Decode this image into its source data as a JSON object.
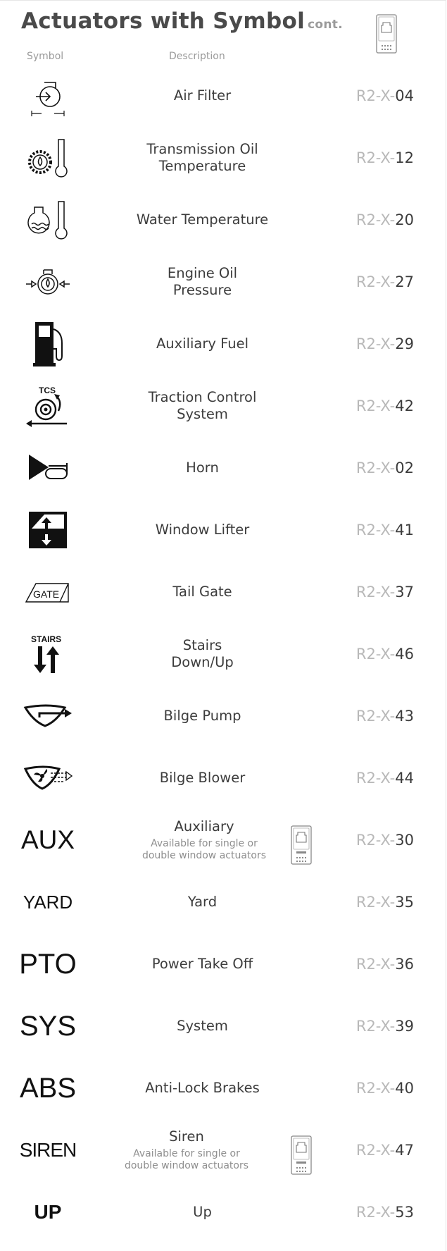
{
  "header": {
    "title": "Actuators with Symbol",
    "cont": "cont.",
    "col_symbol": "Symbol",
    "col_description": "Description"
  },
  "rows": [
    {
      "symbol": "air-filter-icon",
      "desc": "Air Filter",
      "note": "",
      "prefix": "R2-X-",
      "num": "04"
    },
    {
      "symbol": "transmission-oil-temp-icon",
      "desc_lines": [
        "Transmission Oil",
        "Temperature"
      ],
      "prefix": "R2-X-",
      "num": "12"
    },
    {
      "symbol": "water-temp-icon",
      "desc": "Water Temperature",
      "prefix": "R2-X-",
      "num": "20"
    },
    {
      "symbol": "engine-oil-pressure-icon",
      "desc_lines": [
        "Engine Oil",
        "Pressure"
      ],
      "prefix": "R2-X-",
      "num": "27"
    },
    {
      "symbol": "fuel-pump-icon",
      "desc": "Auxiliary Fuel",
      "prefix": "R2-X-",
      "num": "29"
    },
    {
      "symbol": "traction-control-icon",
      "symbol_text": "TCS",
      "desc_lines": [
        "Traction Control",
        "System"
      ],
      "prefix": "R2-X-",
      "num": "42"
    },
    {
      "symbol": "horn-icon",
      "desc": "Horn",
      "prefix": "R2-X-",
      "num": "02"
    },
    {
      "symbol": "window-lifter-icon",
      "desc": "Window Lifter",
      "prefix": "R2-X-",
      "num": "41"
    },
    {
      "symbol": "tail-gate-icon",
      "symbol_text": "GATE",
      "desc": "Tail Gate",
      "prefix": "R2-X-",
      "num": "37"
    },
    {
      "symbol": "stairs-icon",
      "symbol_text": "STAIRS",
      "desc_lines": [
        "Stairs",
        "Down/Up"
      ],
      "prefix": "R2-X-",
      "num": "46"
    },
    {
      "symbol": "bilge-pump-icon",
      "desc": "Bilge Pump",
      "prefix": "R2-X-",
      "num": "43"
    },
    {
      "symbol": "bilge-blower-icon",
      "desc": "Bilge Blower",
      "prefix": "R2-X-",
      "num": "44"
    },
    {
      "symbol": "text",
      "symbol_text": "AUX",
      "desc": "Auxiliary",
      "note_lines": [
        "Available for single or",
        "double window actuators"
      ],
      "prefix": "R2-X-",
      "num": "30"
    },
    {
      "symbol": "text",
      "symbol_text": "YARD",
      "desc": "Yard",
      "prefix": "R2-X-",
      "num": "35"
    },
    {
      "symbol": "text",
      "symbol_text": "PTO",
      "desc": "Power Take Off",
      "prefix": "R2-X-",
      "num": "36"
    },
    {
      "symbol": "text",
      "symbol_text": "SYS",
      "desc": "System",
      "prefix": "R2-X-",
      "num": "39"
    },
    {
      "symbol": "text",
      "symbol_text": "ABS",
      "desc": "Anti-Lock Brakes",
      "prefix": "R2-X-",
      "num": "40"
    },
    {
      "symbol": "text",
      "symbol_text": "SIREN",
      "desc": "Siren",
      "note_lines": [
        "Available for single or",
        "double window actuators"
      ],
      "prefix": "R2-X-",
      "num": "47"
    },
    {
      "symbol": "text",
      "symbol_text": "UP",
      "desc": "Up",
      "prefix": "R2-X-",
      "num": "53"
    }
  ]
}
